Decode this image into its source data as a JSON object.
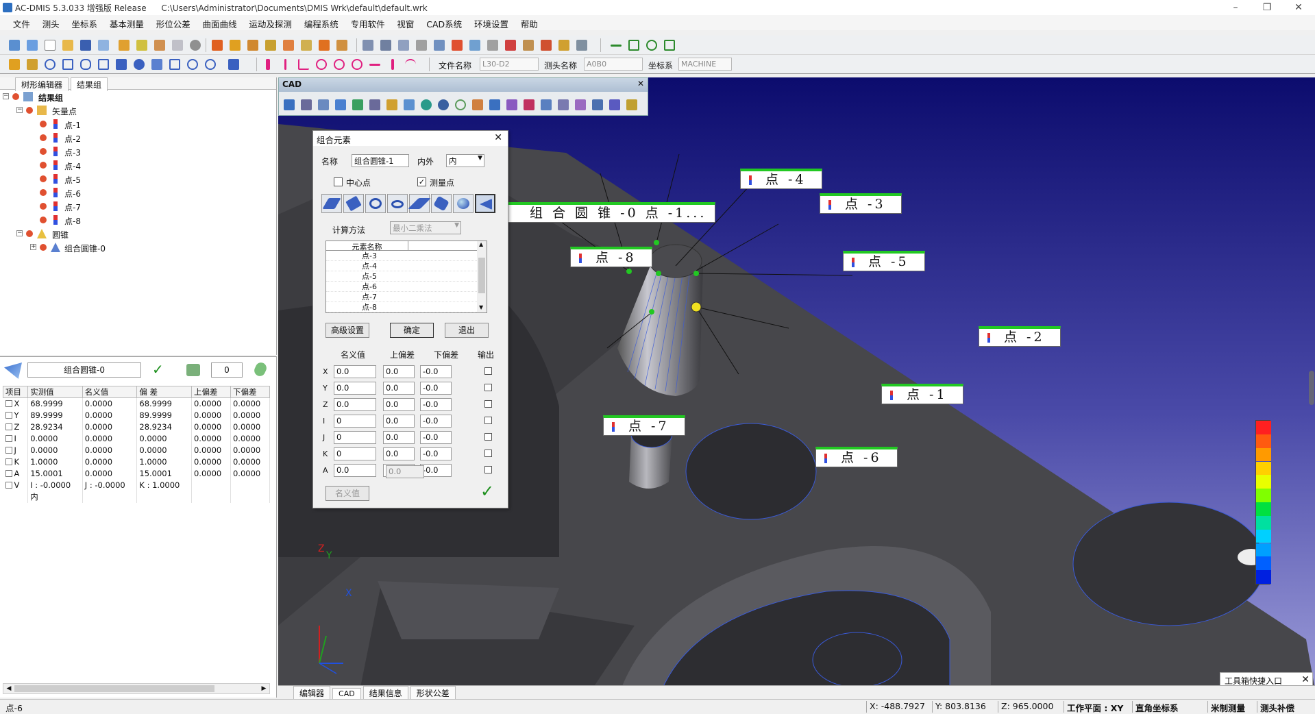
{
  "window": {
    "app_title": "AC-DMIS 5.3.033 增强版 Release",
    "file_path": "C:\\Users\\Administrator\\Documents\\DMIS Wrk\\default\\default.wrk"
  },
  "menu": [
    "文件",
    "测头",
    "坐标系",
    "基本测量",
    "形位公差",
    "曲面曲线",
    "运动及探测",
    "编程系统",
    "专用软件",
    "视窗",
    "CAD系统",
    "环境设置",
    "帮助"
  ],
  "toolbar": {
    "file_label": "文件名称",
    "file_value": "L30-D2",
    "probe_label": "测头名称",
    "probe_value": "A0B0",
    "coord_label": "坐标系",
    "coord_value": "MACHINE"
  },
  "tree": {
    "tabs": [
      "树形编辑器",
      "结果组"
    ],
    "root": "结果组",
    "group1": "矢量点",
    "points": [
      "点-1",
      "点-2",
      "点-3",
      "点-4",
      "点-5",
      "点-6",
      "点-7",
      "点-8"
    ],
    "group2": "圆锥",
    "cone": "组合圆锥-0"
  },
  "props": {
    "name": "组合圆锥-0",
    "count": "0",
    "headers": [
      "项目",
      "实测值",
      "名义值",
      "偏 差",
      "上偏差",
      "下偏差"
    ],
    "rows": [
      [
        "X",
        "68.9999",
        "0.0000",
        "68.9999",
        "0.0000",
        "0.0000"
      ],
      [
        "Y",
        "89.9999",
        "0.0000",
        "89.9999",
        "0.0000",
        "0.0000"
      ],
      [
        "Z",
        "28.9234",
        "0.0000",
        "28.9234",
        "0.0000",
        "0.0000"
      ],
      [
        "I",
        "0.0000",
        "0.0000",
        "0.0000",
        "0.0000",
        "0.0000"
      ],
      [
        "J",
        "0.0000",
        "0.0000",
        "0.0000",
        "0.0000",
        "0.0000"
      ],
      [
        "K",
        "1.0000",
        "0.0000",
        "1.0000",
        "0.0000",
        "0.0000"
      ],
      [
        "A",
        "15.0001",
        "0.0000",
        "15.0001",
        "0.0000",
        "0.0000"
      ]
    ],
    "v_row": [
      "V",
      "I : -0.0000",
      "J : -0.0000",
      "K : 1.0000"
    ],
    "v_extra": "内"
  },
  "cad_toolbar_title": "CAD",
  "dialog": {
    "title": "组合元素",
    "name_label": "名称",
    "name_value": "组合圆锥-1",
    "inout_label": "内外",
    "inout_value": "内",
    "center_label": "中心点",
    "measure_label": "测量点",
    "calc_label": "计算方法",
    "calc_value": "最小二乘法",
    "list_header": "元素名称",
    "list_items": [
      "点-3",
      "点-4",
      "点-5",
      "点-6",
      "点-7",
      "点-8"
    ],
    "adv_button": "高级设置",
    "ok_button": "确定",
    "exit_button": "退出",
    "col_nominal": "名义值",
    "col_upper": "上偏差",
    "col_lower": "下偏差",
    "col_output": "输出",
    "rows": [
      {
        "axis": "X",
        "nom": "0.0",
        "up": "0.0",
        "low": "-0.0"
      },
      {
        "axis": "Y",
        "nom": "0.0",
        "up": "0.0",
        "low": "-0.0"
      },
      {
        "axis": "Z",
        "nom": "0.0",
        "up": "0.0",
        "low": "-0.0"
      },
      {
        "axis": "I",
        "nom": "0",
        "up": "0.0",
        "low": "-0.0"
      },
      {
        "axis": "J",
        "nom": "0",
        "up": "0.0",
        "low": "-0.0"
      },
      {
        "axis": "K",
        "nom": "0",
        "up": "0.0",
        "low": "-0.0"
      },
      {
        "axis": "A",
        "nom": "0.0",
        "up": "0.0",
        "low": "-0.0"
      }
    ],
    "extra_value": "0.0",
    "nominal_button": "名义值"
  },
  "callouts": {
    "main": "组 合 圆 锥 -0 点 -1...",
    "p1": "点 -1",
    "p2": "点 -2",
    "p3": "点 -3",
    "p4": "点 -4",
    "p5": "点 -5",
    "p6": "点 -6",
    "p7": "点 -7",
    "p8": "点 -8"
  },
  "view_tabs": [
    "编辑器",
    "CAD",
    "结果信息",
    "形状公差"
  ],
  "toolbox_label": "工具箱快捷入口",
  "status": {
    "left": "点-6",
    "x": "X: -488.7927",
    "y": "Y: 803.8136",
    "z": "Z: 965.0000",
    "plane": "工作平面 : XY",
    "coordsys": "直角坐标系",
    "unit": "米制测量",
    "probe_comp": "测头补偿"
  },
  "axes": {
    "x": "X",
    "y": "Y",
    "z": "Z"
  },
  "colors": {
    "accent_green": "#22c822",
    "viewport_top": "#0a0a6a",
    "viewport_bottom": "#8b8bd0",
    "part_gray": "#4a4a4e"
  },
  "legend_colors": [
    "#ff2020",
    "#ff5a10",
    "#ff9a00",
    "#ffd000",
    "#e8ff00",
    "#80ff00",
    "#00e040",
    "#00e0a0",
    "#00d0ff",
    "#00a0ff",
    "#0060ff",
    "#0020e0"
  ]
}
